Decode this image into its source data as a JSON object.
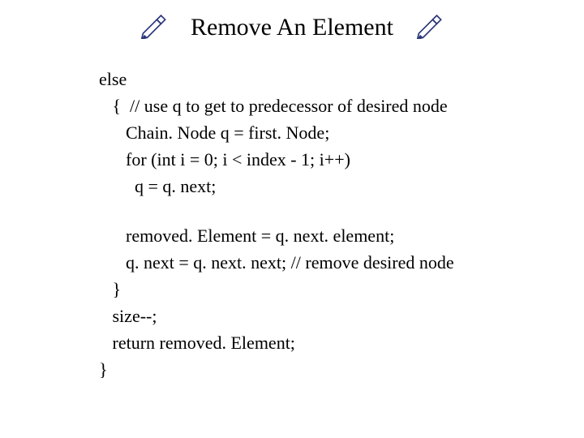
{
  "title": "Remove An Element",
  "icons": {
    "pen_left": "pen-icon",
    "pen_right": "pen-icon"
  },
  "code": {
    "l1": "else",
    "l2": "   {  // use q to get to predecessor of desired node",
    "l3": "      Chain. Node q = first. Node;",
    "l4": "      for (int i = 0; i < index - 1; i++)",
    "l5": "        q = q. next;",
    "l6": "      removed. Element = q. next. element;",
    "l7": "      q. next = q. next. next; // remove desired node",
    "l8": "   }",
    "l9": "   size--;",
    "l10": "   return removed. Element;",
    "l11": "}"
  }
}
